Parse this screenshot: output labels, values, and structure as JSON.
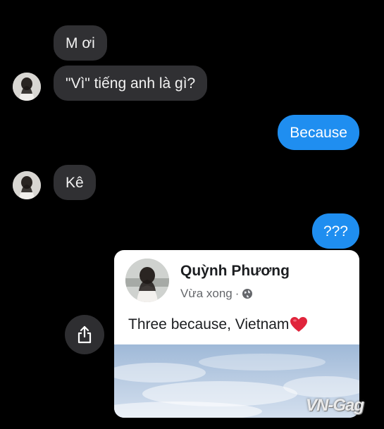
{
  "messages": [
    {
      "side": "in",
      "text": "M ơi"
    },
    {
      "side": "in",
      "text": "\"Vì\" tiếng anh là gì?"
    },
    {
      "side": "out",
      "text": "Because"
    },
    {
      "side": "in",
      "text": "Kê"
    },
    {
      "side": "out",
      "text": "???"
    }
  ],
  "shared_post": {
    "author": "Quỳnh Phương",
    "time": "Vừa xong",
    "separator": "·",
    "audience_icon": "globe-icon",
    "text": "Three because, Vietnam",
    "emoji": "heart-icon"
  },
  "share_button": {
    "icon": "share-icon"
  },
  "watermark": "VN-Gag",
  "colors": {
    "background": "#000000",
    "incoming_bubble": "#303033",
    "outgoing_bubble": "#1f8ef0",
    "card_background": "#ffffff",
    "heart": "#e0243b"
  }
}
